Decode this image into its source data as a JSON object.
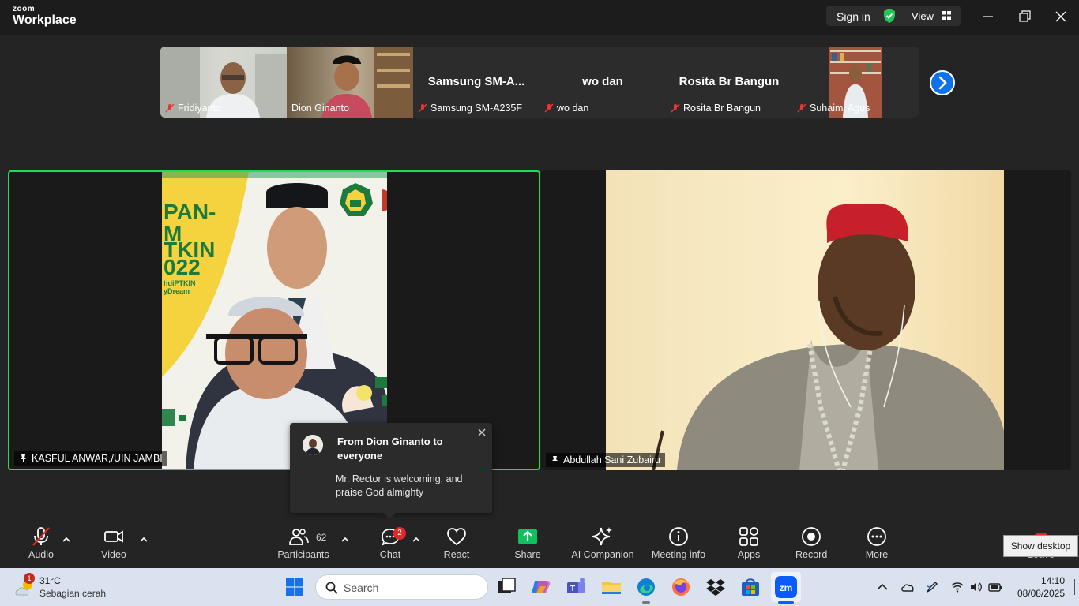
{
  "titlebar": {
    "logo_top": "zoom",
    "logo_bottom": "Workplace",
    "sign_in": "Sign in",
    "view": "View"
  },
  "strip": {
    "thumbs": [
      {
        "label": "Fridiyanto",
        "big": ""
      },
      {
        "label": "Dion Ginanto",
        "big": ""
      },
      {
        "label": "Samsung SM-A235F",
        "big": "Samsung  SM-A..."
      },
      {
        "label": "wo dan",
        "big": "wo dan"
      },
      {
        "label": "Rosita Br Bangun",
        "big": "Rosita Br Bangun"
      },
      {
        "label": "Suhaimi Agus",
        "big": ""
      }
    ]
  },
  "tiles": {
    "left_name": "KASFUL ANWAR,/UIN JAMBI",
    "left_poster_text": [
      "PAN-",
      "M",
      "TKIN",
      "022",
      "hdiPTKIN",
      "yDream"
    ],
    "right_name": "Abdullah Sani Zubairu"
  },
  "chat_popup": {
    "from": "From Dion Ginanto to everyone",
    "message": "Mr. Rector is welcoming, and praise God almighty"
  },
  "toolbar": {
    "audio": "Audio",
    "video": "Video",
    "participants": "Participants",
    "participants_count": "62",
    "chat": "Chat",
    "chat_badge": "2",
    "react": "React",
    "share": "Share",
    "ai": "AI Companion",
    "meeting_info": "Meeting info",
    "apps": "Apps",
    "record": "Record",
    "more": "More",
    "leave": "Leave",
    "tooltip": "Show desktop"
  },
  "taskbar": {
    "weather_badge": "1",
    "temp": "31°C",
    "weather_desc": "Sebagian cerah",
    "search_placeholder": "Search",
    "time": "14:10",
    "date": "08/08/2025"
  },
  "colors": {
    "active_speaker": "#23d959",
    "zoom_blue": "#0e72ed",
    "share_green": "#0ec15c"
  }
}
